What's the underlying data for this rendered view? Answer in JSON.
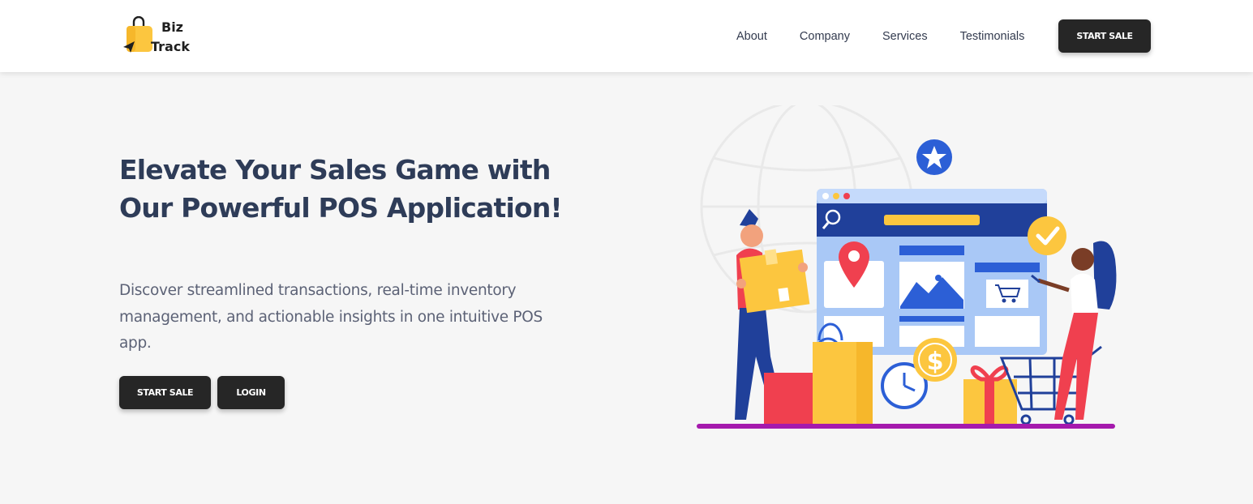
{
  "header": {
    "logo": {
      "line1": "Biz",
      "line2": "Track",
      "icon": "shopping-bag-icon"
    },
    "nav": [
      {
        "label": "About"
      },
      {
        "label": "Company"
      },
      {
        "label": "Services"
      },
      {
        "label": "Testimonials"
      }
    ],
    "cta_label": "START SALE"
  },
  "hero": {
    "title": "Elevate Your Sales Game with Our Powerful POS Application!",
    "description": "Discover streamlined transactions, real-time inventory management, and actionable insights in one intuitive POS app.",
    "buttons": {
      "start_label": "START SALE",
      "login_label": "LOGIN"
    }
  },
  "colors": {
    "dark_button": "#262626",
    "heading": "#2e3c58",
    "body_text": "#5c6276",
    "accent_yellow": "#fcc63f",
    "accent_blue": "#2c5fd6",
    "accent_red": "#f0404f",
    "ground_purple": "#a51aad"
  }
}
